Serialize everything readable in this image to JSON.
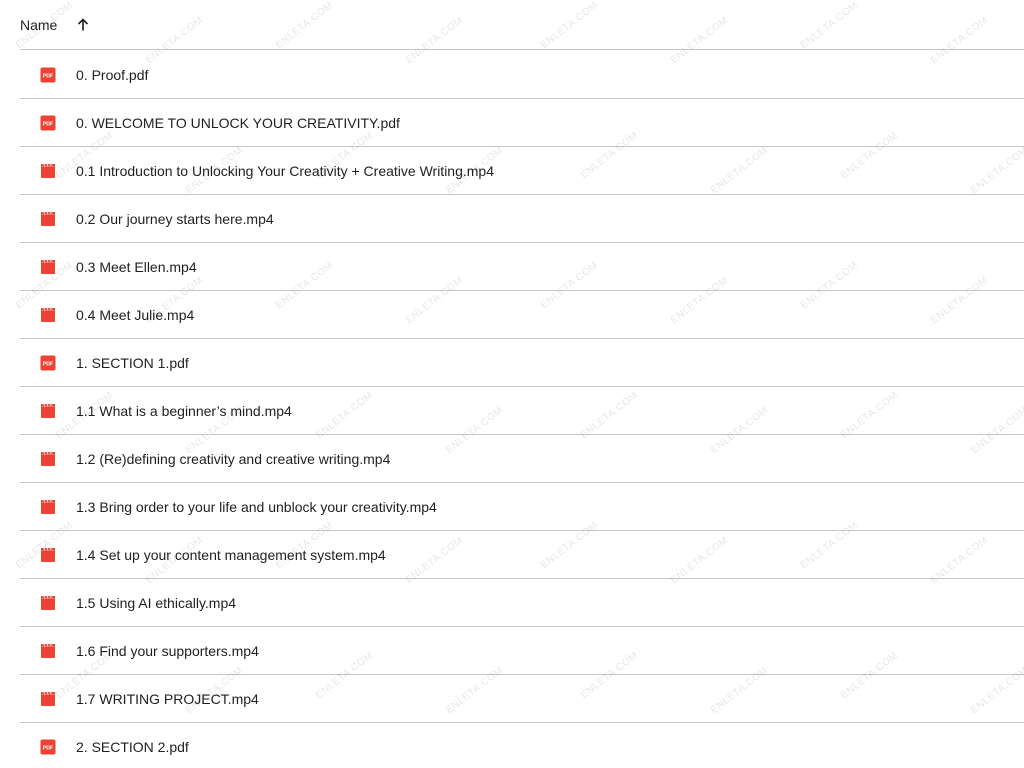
{
  "header": {
    "name_label": "Name",
    "sort_icon": "arrow-up-icon"
  },
  "files": [
    {
      "name": "0. Proof.pdf",
      "type": "pdf",
      "icon": "pdf-icon"
    },
    {
      "name": "0. WELCOME TO UNLOCK YOUR CREATIVITY.pdf",
      "type": "pdf",
      "icon": "pdf-icon"
    },
    {
      "name": "0.1 Introduction to Unlocking Your Creativity + Creative Writing.mp4",
      "type": "video",
      "icon": "video-icon"
    },
    {
      "name": "0.2 Our journey starts here.mp4",
      "type": "video",
      "icon": "video-icon"
    },
    {
      "name": "0.3 Meet Ellen.mp4",
      "type": "video",
      "icon": "video-icon"
    },
    {
      "name": "0.4 Meet Julie.mp4",
      "type": "video",
      "icon": "video-icon"
    },
    {
      "name": "1. SECTION 1.pdf",
      "type": "pdf",
      "icon": "pdf-icon"
    },
    {
      "name": "1.1 What is a beginner’s mind.mp4",
      "type": "video",
      "icon": "video-icon"
    },
    {
      "name": "1.2 (Re)defining creativity and creative writing.mp4",
      "type": "video",
      "icon": "video-icon"
    },
    {
      "name": "1.3 Bring order to your life and unblock your creativity.mp4",
      "type": "video",
      "icon": "video-icon"
    },
    {
      "name": "1.4 Set up your content management system.mp4",
      "type": "video",
      "icon": "video-icon"
    },
    {
      "name": "1.5 Using AI ethically.mp4",
      "type": "video",
      "icon": "video-icon"
    },
    {
      "name": "1.6 Find your supporters.mp4",
      "type": "video",
      "icon": "video-icon"
    },
    {
      "name": "1.7 WRITING PROJECT.mp4",
      "type": "video",
      "icon": "video-icon"
    },
    {
      "name": "2. SECTION 2.pdf",
      "type": "pdf",
      "icon": "pdf-icon"
    }
  ],
  "icon_labels": {
    "pdf": "PDF"
  },
  "watermark": {
    "text": "ENLETA.COM"
  },
  "colors": {
    "file_icon_red": "#ea4335",
    "divider": "#c7c7c7",
    "text": "#1f1f1f"
  }
}
